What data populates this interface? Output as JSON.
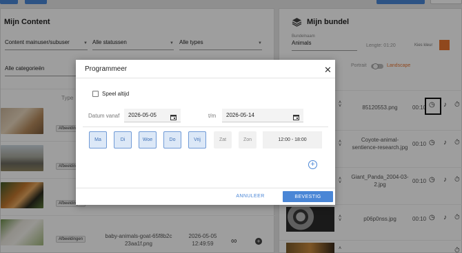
{
  "topbar": {
    "left_btn_1": "",
    "left_btn_2": "",
    "right_btn_1": "",
    "right_btn_2": ""
  },
  "left_panel": {
    "title": "Mijn Content",
    "filters": [
      {
        "value": "Content mainuser/subuser"
      },
      {
        "value": "Alle statussen"
      },
      {
        "value": "Alle types"
      },
      {
        "value": "Alle categorieën"
      }
    ],
    "type_header": "Type",
    "rows": [
      {
        "tag": "Afbeeldingen"
      },
      {
        "tag": "Afbeeldingen"
      },
      {
        "tag": "Afbeeldingen"
      },
      {
        "tag": "Afbeeldingen",
        "filename": "baby-animals-goat-65f8b2c23aa1f.png",
        "date": "2026-05-05",
        "time": "12:49:59"
      }
    ]
  },
  "right_panel": {
    "title": "Mijn bundel",
    "bundle_name_label": "Bundelnaam",
    "bundle_name": "Animals",
    "length_label": "Lengte: 01:20",
    "color_label": "Kies kleur",
    "accent": "#e8742f",
    "portrait_label": "Portrait",
    "landscape_label": "Landscape",
    "items": [
      {
        "name": "85120553.png",
        "duration": "00:10"
      },
      {
        "name": "Coyote-animal-sentience-research.jpg",
        "duration": "00:10"
      },
      {
        "name": "Giant_Panda_2004-03-2.jpg",
        "duration": "00:10"
      },
      {
        "name": "p06p0nss.jpg",
        "duration": "00:10"
      },
      {
        "name": "",
        "duration": ""
      }
    ]
  },
  "modal": {
    "title": "Programmeer",
    "play_always_label": "Speel altijd",
    "date_from_label": "Datum vanaf",
    "date_from": "2026-05-05",
    "date_to_label": "t/m",
    "date_to": "2026-05-14",
    "days": [
      {
        "label": "Ma",
        "active": true
      },
      {
        "label": "Di",
        "active": true
      },
      {
        "label": "Woe",
        "active": true
      },
      {
        "label": "Do",
        "active": true
      },
      {
        "label": "Vrij",
        "active": true
      },
      {
        "label": "Zat",
        "active": false
      },
      {
        "label": "Zon",
        "active": false
      }
    ],
    "time_range": "12:00 - 18:00",
    "cancel_label": "ANNULEER",
    "confirm_label": "BEVESTIG",
    "accent": "#4a86d6"
  }
}
